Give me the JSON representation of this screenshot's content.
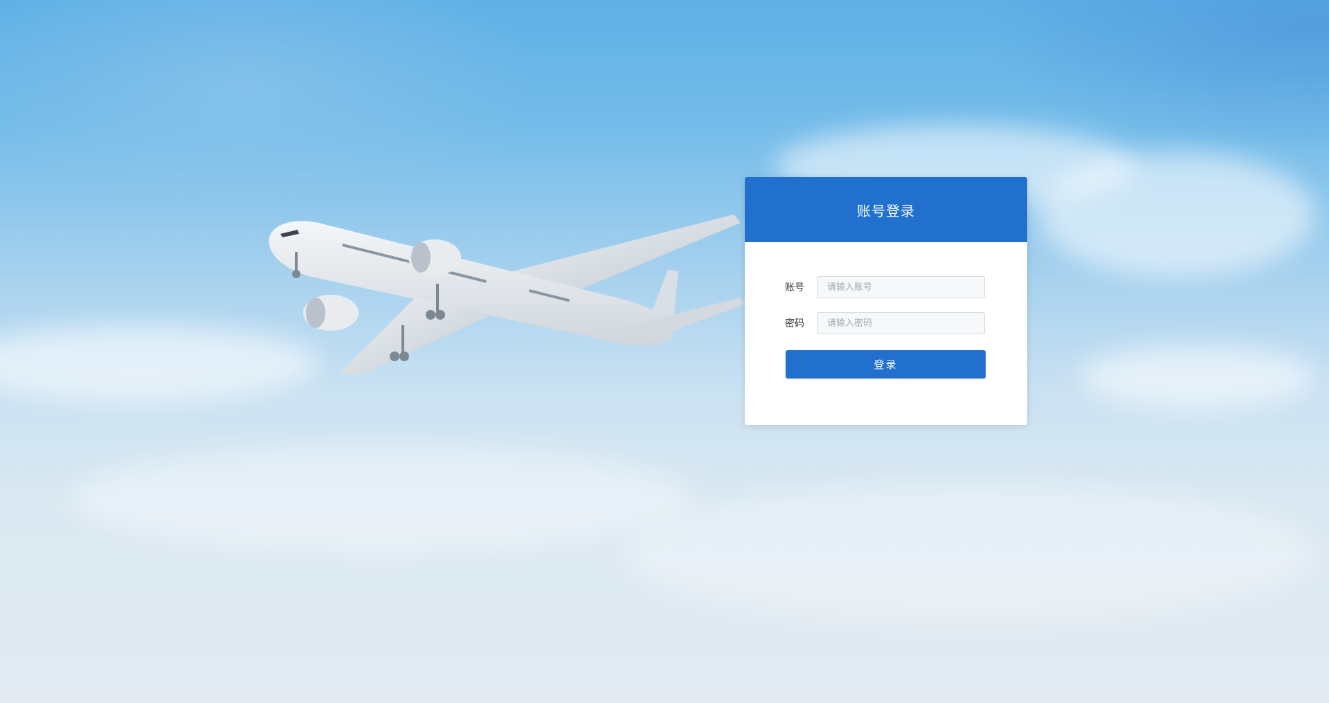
{
  "login": {
    "title": "账号登录",
    "account": {
      "label": "账号",
      "placeholder": "请输入账号",
      "value": ""
    },
    "password": {
      "label": "密码",
      "placeholder": "请输入密码",
      "value": ""
    },
    "submit_label": "登录"
  },
  "colors": {
    "primary": "#2170cd",
    "card_background": "#ffffff"
  }
}
